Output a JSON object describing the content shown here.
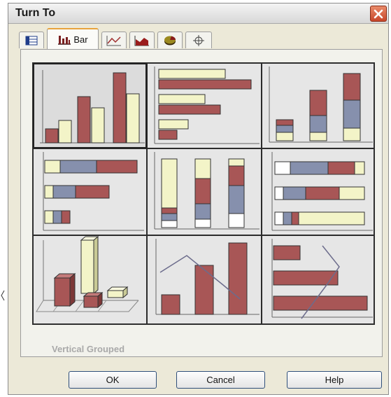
{
  "dialog": {
    "title": "Turn To",
    "close_icon": "close-icon"
  },
  "tabs": [
    {
      "name": "table",
      "icon": "table-icon",
      "label": ""
    },
    {
      "name": "bar",
      "icon": "bar-chart-icon",
      "label": "Bar",
      "active": true
    },
    {
      "name": "line",
      "icon": "line-chart-icon",
      "label": ""
    },
    {
      "name": "area",
      "icon": "area-chart-icon",
      "label": ""
    },
    {
      "name": "pie",
      "icon": "pie-chart-icon",
      "label": ""
    },
    {
      "name": "scatter",
      "icon": "crosshair-icon",
      "label": ""
    }
  ],
  "gallery": {
    "selected_type_label": "Vertical Grouped",
    "thumbnails": [
      "vertical-grouped",
      "horizontal-grouped",
      "vertical-stacked",
      "horizontal-stacked",
      "vertical-percent-stacked",
      "horizontal-percent-stacked",
      "3d-bar",
      "bar-line-combo",
      "horizontal-bar-line-combo"
    ]
  },
  "buttons": {
    "ok": "OK",
    "cancel": "Cancel",
    "help": "Help"
  },
  "colors": {
    "bar_red": "#a85656",
    "bar_cream": "#f3f4c8",
    "bar_blue": "#8690ad",
    "bar_white": "#ffffff",
    "line": "#6c6c8c",
    "active_tab_accent": "#e8a33c"
  }
}
